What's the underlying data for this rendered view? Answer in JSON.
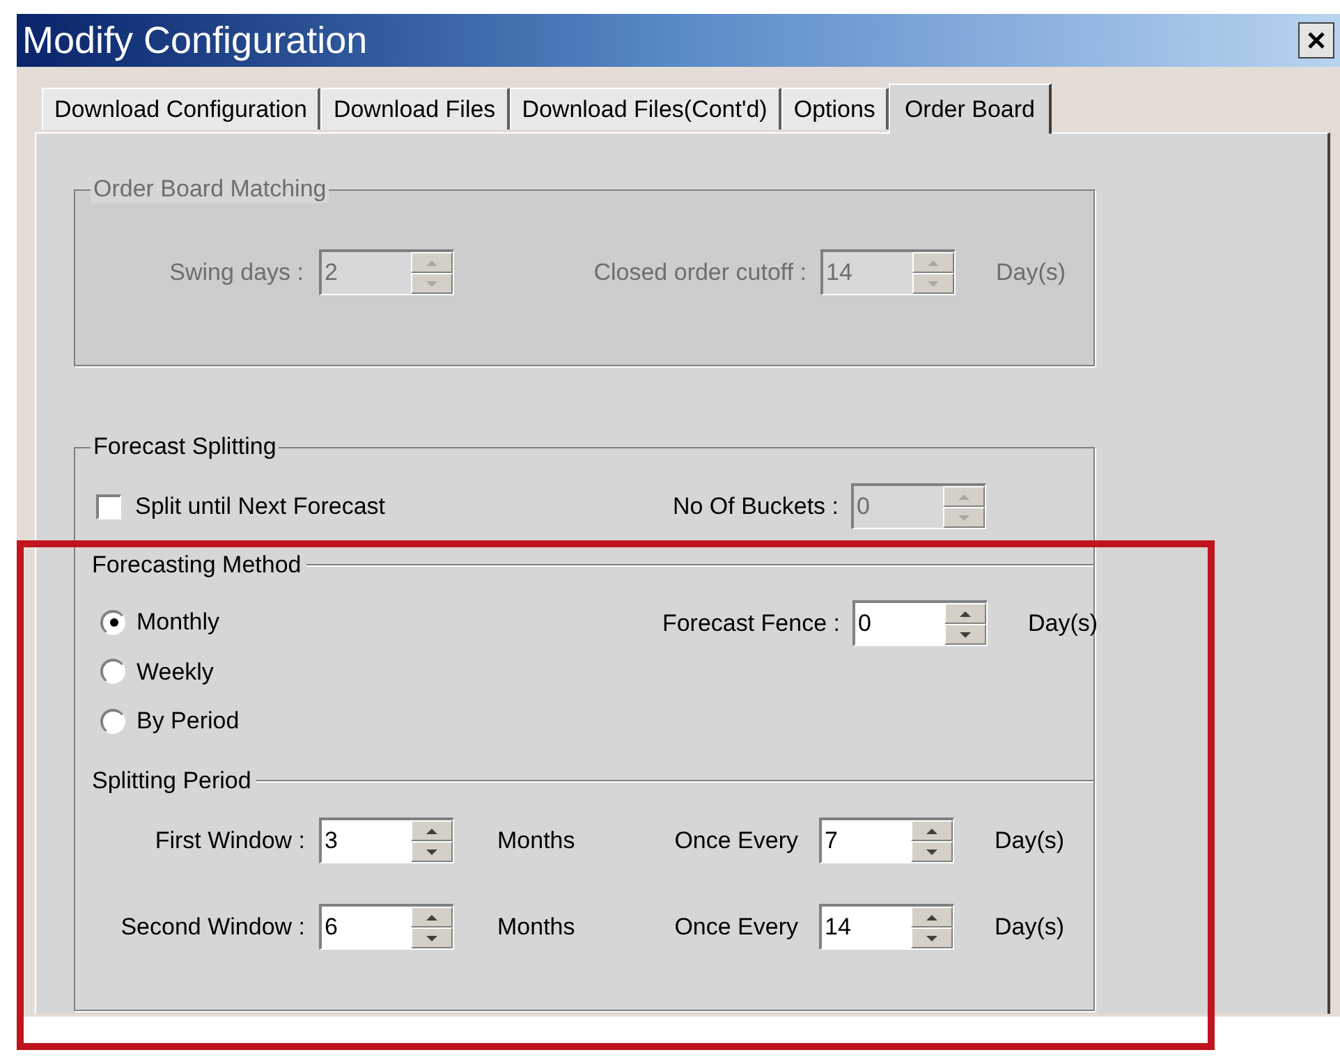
{
  "window": {
    "title": "Modify Configuration"
  },
  "tabs": [
    {
      "label": "Download Configuration",
      "selected": false
    },
    {
      "label": "Download Files",
      "selected": false
    },
    {
      "label": "Download Files(Cont'd)",
      "selected": false
    },
    {
      "label": "Options",
      "selected": false
    },
    {
      "label": "Order Board",
      "selected": true
    }
  ],
  "order_board_matching": {
    "title": "Order Board Matching",
    "disabled": true,
    "swing_days": {
      "label": "Swing days :",
      "value": "2"
    },
    "closed_order_cutoff": {
      "label": "Closed order cutoff :",
      "value": "14",
      "unit": "Day(s)"
    }
  },
  "forecast_splitting": {
    "title": "Forecast Splitting",
    "split_checkbox": {
      "label": "Split until Next Forecast",
      "checked": false
    },
    "buckets": {
      "label": "No Of Buckets :",
      "value": "0",
      "disabled": true
    }
  },
  "forecasting_method": {
    "title": "Forecasting Method",
    "options": [
      {
        "label": "Monthly",
        "selected": true
      },
      {
        "label": "Weekly",
        "selected": false
      },
      {
        "label": "By Period",
        "selected": false
      }
    ],
    "fence": {
      "label": "Forecast Fence :",
      "value": "0",
      "unit": "Day(s)"
    }
  },
  "splitting_period": {
    "title": "Splitting Period",
    "rows": [
      {
        "label": "First Window :",
        "value": "3",
        "unit": "Months",
        "every_label": "Once Every",
        "every_value": "7",
        "every_unit": "Day(s)"
      },
      {
        "label": "Second Window :",
        "value": "6",
        "unit": "Months",
        "every_label": "Once Every",
        "every_value": "14",
        "every_unit": "Day(s)"
      }
    ]
  }
}
